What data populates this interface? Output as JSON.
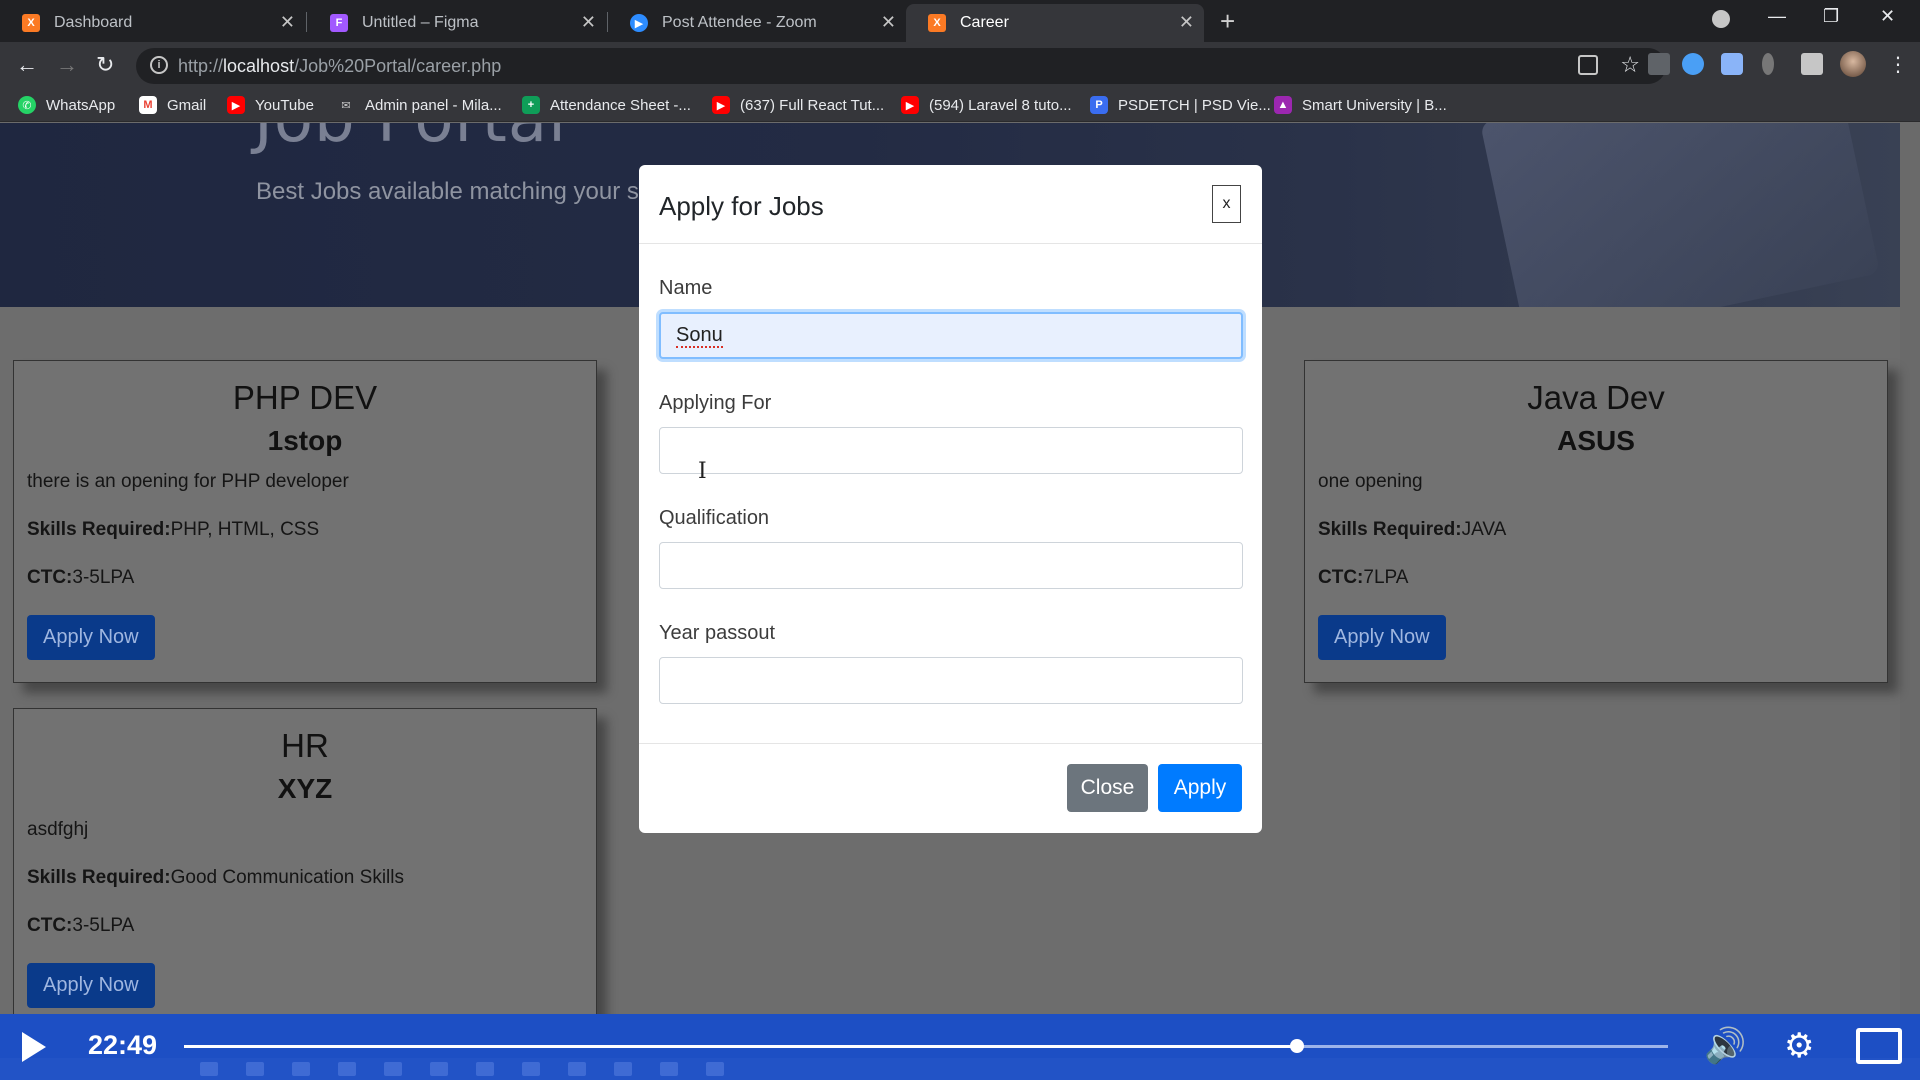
{
  "browser": {
    "tabs": [
      {
        "label": "Dashboard",
        "icon": "xampp-icon",
        "color": "#fb7a24"
      },
      {
        "label": "Untitled – Figma",
        "icon": "figma-icon",
        "color": "#a259ff"
      },
      {
        "label": "Post Attendee - Zoom",
        "icon": "zoom-icon",
        "color": "#2d8cff"
      },
      {
        "label": "Career",
        "icon": "xampp-icon",
        "color": "#fb7a24"
      }
    ],
    "new_tab": "+",
    "close_glyph": "✕",
    "window_controls": {
      "minimize": "—",
      "restore": "❐",
      "close": "✕"
    },
    "url_prefix": "http://",
    "url_host": "localhost",
    "url_path": "/Job%20Portal/career.php",
    "bookmarks": [
      {
        "label": "WhatsApp",
        "icon": "whatsapp-icon",
        "color": "#25d366"
      },
      {
        "label": "Gmail",
        "icon": "gmail-icon",
        "color": "#ea4335"
      },
      {
        "label": "YouTube",
        "icon": "youtube-icon",
        "color": "#ff0000"
      },
      {
        "label": "Admin panel - Mila...",
        "icon": "envelope-icon",
        "color": "#9aa0a6"
      },
      {
        "label": "Attendance Sheet -...",
        "icon": "sheets-icon",
        "color": "#0f9d58"
      },
      {
        "label": "(637) Full React Tut...",
        "icon": "youtube-icon",
        "color": "#ff0000"
      },
      {
        "label": "(594) Laravel 8 tuto...",
        "icon": "youtube-icon",
        "color": "#ff0000"
      },
      {
        "label": "PSDETCH | PSD Vie...",
        "icon": "psdetch-icon",
        "color": "#3a6df0"
      },
      {
        "label": "Smart University | B...",
        "icon": "university-icon",
        "color": "#9c27b0"
      }
    ]
  },
  "hero": {
    "title": "Job Portal",
    "subtitle": "Best Jobs available matching your ski"
  },
  "jobs": [
    {
      "title": "PHP DEV",
      "company": "1stop",
      "description": "there is an opening for PHP developer",
      "skills_label": "Skills Required:",
      "skills": "PHP, HTML, CSS",
      "ctc_label": "CTC:",
      "ctc": "3-5LPA",
      "button": "Apply Now"
    },
    {
      "title": "Java Dev",
      "company": "ASUS",
      "description": "one opening",
      "skills_label": "Skills Required:",
      "skills": "JAVA",
      "ctc_label": "CTC:",
      "ctc": "7LPA",
      "button": "Apply Now"
    },
    {
      "title": "HR",
      "company": "XYZ",
      "description": "asdfghj",
      "skills_label": "Skills Required:",
      "skills": "Good Communication Skills",
      "ctc_label": "CTC:",
      "ctc": "3-5LPA",
      "button": "Apply Now"
    }
  ],
  "modal": {
    "title": "Apply for Jobs",
    "close_x": "x",
    "fields": [
      {
        "label": "Name",
        "value": "Sonu"
      },
      {
        "label": "Applying For",
        "value": ""
      },
      {
        "label": "Qualification",
        "value": ""
      },
      {
        "label": "Year passout",
        "value": ""
      }
    ],
    "close_button": "Close",
    "apply_button": "Apply"
  },
  "player": {
    "time": "22:49",
    "progress": 0.75,
    "volume_icon": "volume-icon",
    "settings_icon": "gear-icon",
    "fullscreen_icon": "fullscreen-icon"
  }
}
